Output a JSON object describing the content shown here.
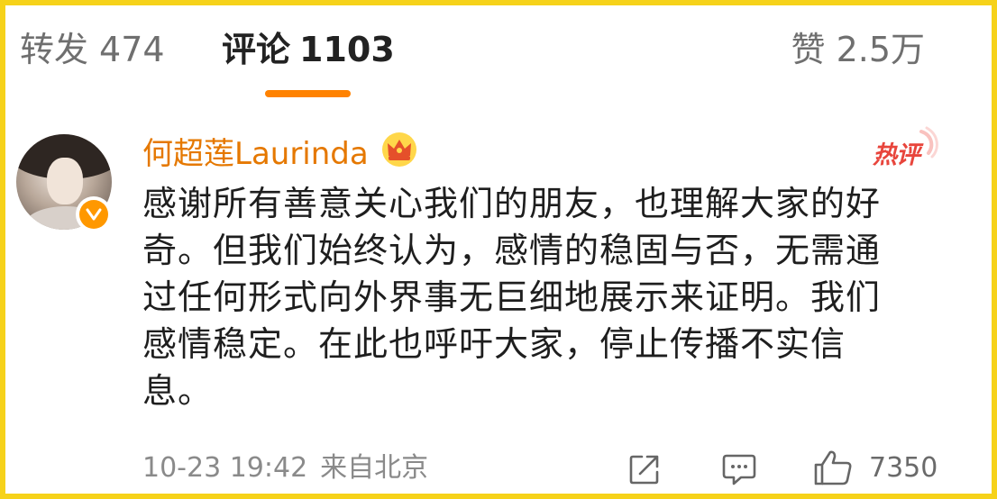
{
  "tabs": {
    "repost": {
      "label": "转发",
      "count": "474"
    },
    "comments": {
      "label": "评论",
      "count": "1103"
    },
    "likes": {
      "label": "赞",
      "count": "2.5万"
    }
  },
  "comment": {
    "username": "何超莲Laurinda",
    "hot_label": "热评",
    "lines": [
      "感谢所有善意关心我们的朋友，也理解大家的好",
      "奇。但我们始终认为，感情的稳固与否，无需通",
      "过任何形式向外界事无巨细地展示来证明。我们",
      "感情稳定。在此也呼吁大家，停止传播不实信",
      "息。"
    ],
    "timestamp": "10-23 19:42",
    "source": "来自北京",
    "like_count": "7350"
  },
  "colors": {
    "frame": "#f6d21a",
    "accent": "#ff8200",
    "username": "#e57800",
    "hot": "#e8453c"
  },
  "icons": [
    "crown-icon",
    "verified-icon",
    "share-icon",
    "comment-icon",
    "like-icon"
  ]
}
